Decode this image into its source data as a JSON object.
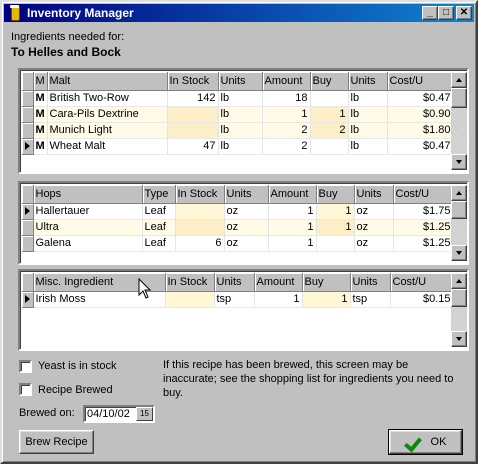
{
  "window": {
    "title": "Inventory Manager"
  },
  "header": {
    "ingredients_label": "Ingredients needed for:",
    "recipe_name": "To Helles and Bock"
  },
  "malt": {
    "columns": [
      "M",
      "Malt",
      "In Stock",
      "Units",
      "Amount",
      "Buy",
      "Units",
      "Cost/U"
    ],
    "rows": [
      {
        "m": "M",
        "name": "British Two-Row",
        "stock": "142",
        "units": "lb",
        "amount": "18",
        "buy": "",
        "bunits": "lb",
        "cost": "$0.47"
      },
      {
        "m": "M",
        "name": "Cara-Pils Dextrine",
        "stock": "",
        "units": "lb",
        "amount": "1",
        "buy": "1",
        "bunits": "lb",
        "cost": "$0.90"
      },
      {
        "m": "M",
        "name": "Munich Light",
        "stock": "",
        "units": "lb",
        "amount": "2",
        "buy": "2",
        "bunits": "lb",
        "cost": "$1.80"
      },
      {
        "m": "M",
        "name": "Wheat Malt",
        "stock": "47",
        "units": "lb",
        "amount": "2",
        "buy": "",
        "bunits": "lb",
        "cost": "$0.47"
      }
    ]
  },
  "hops": {
    "columns": [
      "Hops",
      "Type",
      "In Stock",
      "Units",
      "Amount",
      "Buy",
      "Units",
      "Cost/U"
    ],
    "rows": [
      {
        "name": "Hallertauer",
        "type": "Leaf",
        "stock": "",
        "units": "oz",
        "amount": "1",
        "buy": "1",
        "bunits": "oz",
        "cost": "$1.75"
      },
      {
        "name": "Ultra",
        "type": "Leaf",
        "stock": "",
        "units": "oz",
        "amount": "1",
        "buy": "1",
        "bunits": "oz",
        "cost": "$1.25"
      },
      {
        "name": "Galena",
        "type": "Leaf",
        "stock": "6",
        "units": "oz",
        "amount": "1",
        "buy": "",
        "bunits": "oz",
        "cost": "$1.25"
      }
    ]
  },
  "misc": {
    "columns": [
      "Misc. Ingredient",
      "In Stock",
      "Units",
      "Amount",
      "Buy",
      "Units",
      "Cost/U"
    ],
    "rows": [
      {
        "name": "Irish Moss",
        "stock": "",
        "units": "tsp",
        "amount": "1",
        "buy": "1",
        "bunits": "tsp",
        "cost": "$0.15"
      }
    ]
  },
  "options": {
    "yeast_label": "Yeast is in stock",
    "brewed_label": "Recipe Brewed",
    "note": "If this recipe has been brewed, this screen may be inaccurate; see the shopping list for ingredients you need to buy.",
    "brewed_on_label": "Brewed on:",
    "brewed_on_value": "04/10/02",
    "calendar_label": "15"
  },
  "buttons": {
    "brew": "Brew Recipe",
    "ok": "OK"
  },
  "titlebar_buttons": {
    "minimize": "_",
    "maximize": "□",
    "close": "✕"
  }
}
